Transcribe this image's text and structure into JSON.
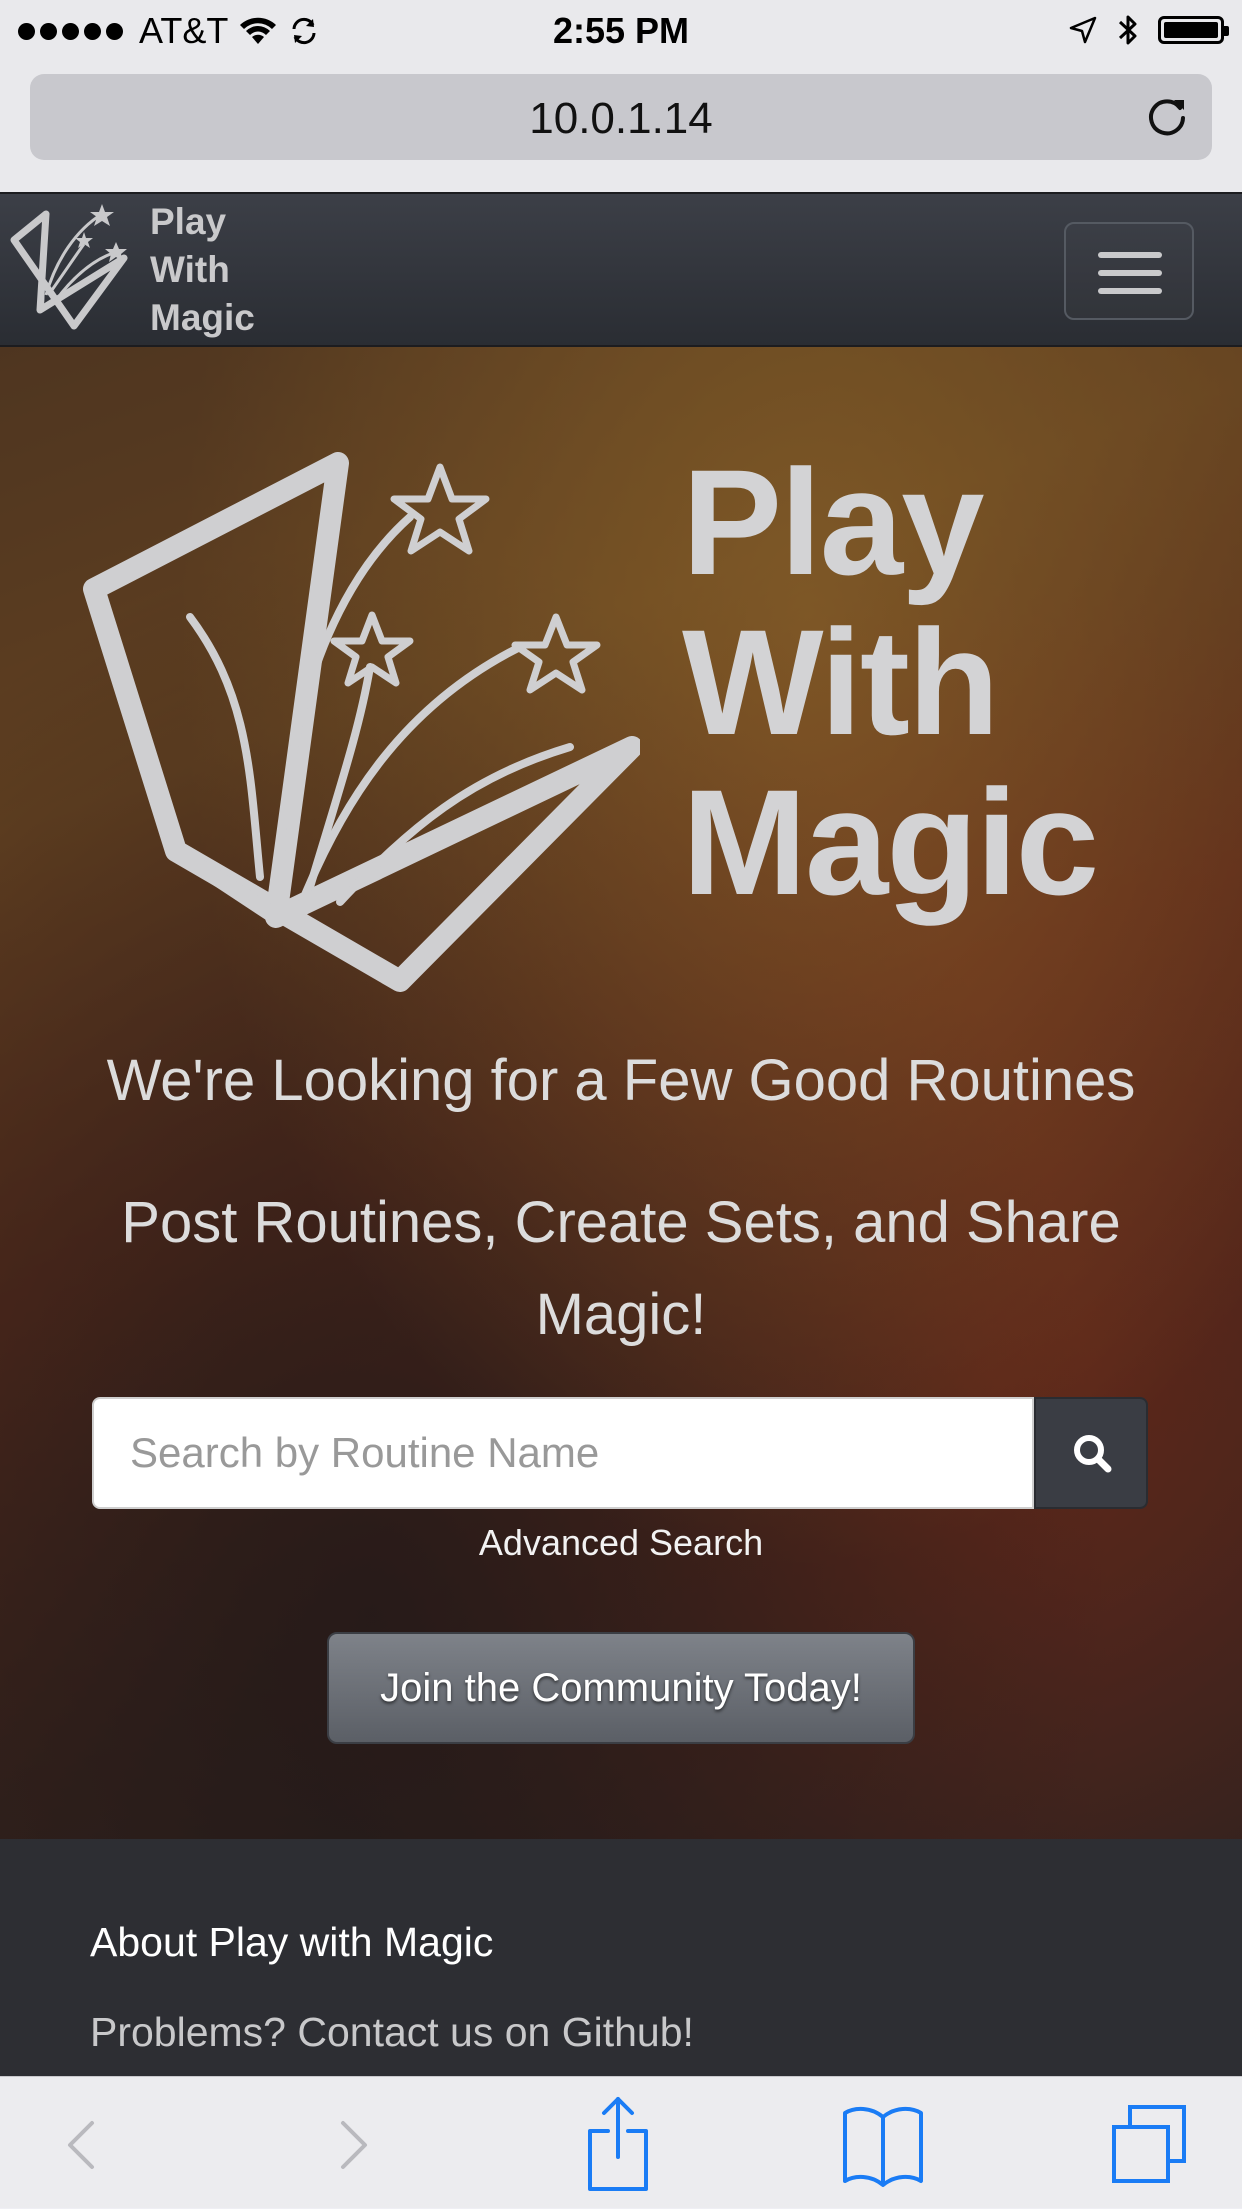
{
  "status_bar": {
    "carrier": "AT&T",
    "time": "2:55 PM",
    "icons": [
      "signal-dots",
      "wifi-icon",
      "sync-icon",
      "location-arrow-icon",
      "bluetooth-icon",
      "battery-icon"
    ]
  },
  "browser": {
    "url": "10.0.1.14",
    "reload_icon": "reload-icon"
  },
  "navbar": {
    "brand_line1": "Play",
    "brand_line2": "With",
    "brand_line3": "Magic",
    "logo_icon": "book-stars-logo",
    "menu_icon": "hamburger-menu-icon"
  },
  "hero": {
    "title_line1": "Play",
    "title_line2": "With",
    "title_line3": "Magic",
    "tagline": "We're Looking for a Few Good Routines",
    "subtagline": "Post Routines, Create Sets, and Share Magic!",
    "search_placeholder": "Search by Routine Name",
    "search_value": "",
    "search_icon": "search-icon",
    "advanced_search": "Advanced Search",
    "join_button": "Join the Community Today!"
  },
  "footer": {
    "about": "About Play with Magic",
    "contact": "Problems? Contact us on Github!"
  },
  "toolbar": {
    "items": [
      "back-icon",
      "forward-icon",
      "share-icon",
      "bookmarks-icon",
      "tabs-icon"
    ]
  },
  "colors": {
    "navbar_bg": "#2f3238",
    "footer_bg": "#2d2e33",
    "ios_blue": "#1a7cf5",
    "logo_gray": "#c9c9cb"
  }
}
